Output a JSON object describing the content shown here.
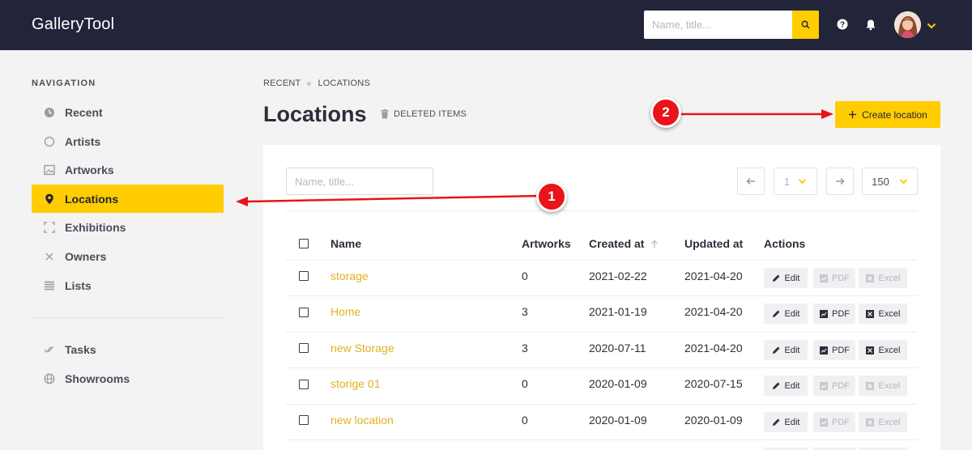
{
  "app": {
    "title": "GalleryTool"
  },
  "header": {
    "search_placeholder": "Name, title...",
    "icons": [
      "search-icon",
      "help-icon",
      "bell-icon",
      "avatar",
      "chevron-down-icon"
    ]
  },
  "sidebar": {
    "title": "NAVIGATION",
    "items": [
      {
        "label": "Recent",
        "icon": "clock-icon",
        "active": false
      },
      {
        "label": "Artists",
        "icon": "circle-icon",
        "active": false
      },
      {
        "label": "Artworks",
        "icon": "image-icon",
        "active": false
      },
      {
        "label": "Locations",
        "icon": "location-pin-icon",
        "active": true
      },
      {
        "label": "Exhibitions",
        "icon": "frame-icon",
        "active": false
      },
      {
        "label": "Owners",
        "icon": "close-icon",
        "active": false
      },
      {
        "label": "Lists",
        "icon": "list-icon",
        "active": false
      }
    ],
    "secondary_items": [
      {
        "label": "Tasks",
        "icon": "double-check-icon"
      },
      {
        "label": "Showrooms",
        "icon": "globe-icon"
      }
    ]
  },
  "breadcrumb": {
    "items": [
      "RECENT",
      "LOCATIONS"
    ]
  },
  "page": {
    "title": "Locations",
    "deleted_items": "DELETED ITEMS",
    "create_button": "Create location"
  },
  "table_controls": {
    "filter_placeholder": "Name, title...",
    "page": "1",
    "per_page": "150"
  },
  "table": {
    "columns": [
      "Name",
      "Artworks",
      "Created at",
      "Updated at",
      "Actions"
    ],
    "sorted_column": "Created at",
    "action_labels": {
      "edit": "Edit",
      "pdf": "PDF",
      "excel": "Excel"
    },
    "rows": [
      {
        "name": "storage",
        "artworks": "0",
        "created": "2021-02-22",
        "updated": "2021-04-20",
        "export_enabled": false
      },
      {
        "name": "Home",
        "artworks": "3",
        "created": "2021-01-19",
        "updated": "2021-04-20",
        "export_enabled": true
      },
      {
        "name": "new Storage",
        "artworks": "3",
        "created": "2020-07-11",
        "updated": "2021-04-20",
        "export_enabled": true
      },
      {
        "name": "storige 01",
        "artworks": "0",
        "created": "2020-01-09",
        "updated": "2020-07-15",
        "export_enabled": false
      },
      {
        "name": "new location",
        "artworks": "0",
        "created": "2020-01-09",
        "updated": "2020-01-09",
        "export_enabled": false
      }
    ]
  },
  "annotations": [
    {
      "label": "1",
      "target": "sidebar Locations item"
    },
    {
      "label": "2",
      "target": "Create location button"
    }
  ],
  "colors": {
    "accent": "#ffcd00",
    "topbar": "#22253a",
    "link": "#e0b220",
    "annotation": "#e8141a"
  }
}
